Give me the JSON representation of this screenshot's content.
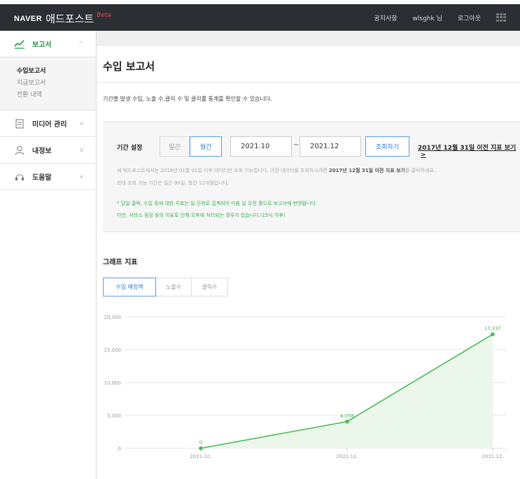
{
  "header": {
    "brand": "NAVER",
    "app_name": "애드포스트",
    "beta": "Beta",
    "nav": [
      "공지사항",
      "wlsghk 님",
      "로그아웃"
    ],
    "apps_icon": "grid-icon"
  },
  "sidebar": {
    "report": {
      "label": "보고서",
      "icon": "chart-line-icon",
      "chevron": "^"
    },
    "report_sub": [
      "수입보고서",
      "지급보고서",
      "전환 내역"
    ],
    "items": [
      {
        "label": "미디어 관리",
        "icon": "document-icon"
      },
      {
        "label": "내정보",
        "icon": "user-icon"
      },
      {
        "label": "도움말",
        "icon": "headset-icon"
      }
    ],
    "chevron": "v"
  },
  "page": {
    "title": "수입 보고서",
    "description": "기간별 발생 수입, 노출 수,클릭 수 및 클릭률 통계를 확인할 수 있습니다."
  },
  "filter": {
    "label": "기간 설정",
    "day_btn": "일간",
    "month_btn": "월간",
    "start": "2021.10",
    "tilde": "~",
    "end": "2021.12",
    "search_btn": "조회하기",
    "old_link": "2017년 12월 31일 이전 지표 보기",
    "old_arrow": ">",
    "note1_a": "새 애드포스트에서는 2018년 01월 01일 이후 데이터만 조회 가능합니다. 이전 데이터를 조회하시려면 ",
    "note1_b": "2017년 12월 31일 이전 지표 보기",
    "note1_c": "를 클릭하세요.",
    "note2": "최대 조회 가능 기간은 일간 90일, 월간 12개월입니다.",
    "note3": "* 당일 클릭, 수입 등에 대한 지표는 일 단위로 집계되어 다음 날 오전 중으로 보고서에 반영됩니다.",
    "note4": "다만, 서비스 점검 등의 이유로 인해 오후에 처리되는 경우가 있습니다.(15시 이후)"
  },
  "graph": {
    "title": "그래프 지표",
    "tabs": [
      "수입 예정액",
      "노출수",
      "클릭수"
    ]
  },
  "colors": {
    "accent_green": "#4cbb55",
    "accent_blue": "#2f7cd3",
    "topbar": "#2b2f33"
  },
  "chart_data": {
    "type": "area",
    "categories": [
      "2021.10.",
      "2021.11.",
      "2021.12."
    ],
    "values": [
      0,
      4058,
      17337
    ],
    "data_labels": [
      "0",
      "4,058",
      "17,337"
    ],
    "y_ticks": [
      0,
      5000,
      10000,
      15000,
      20000
    ],
    "y_tick_labels": [
      "0",
      "5,000",
      "10,000",
      "15,000",
      "20,000"
    ],
    "ylim": [
      0,
      20000
    ],
    "grid": true
  }
}
